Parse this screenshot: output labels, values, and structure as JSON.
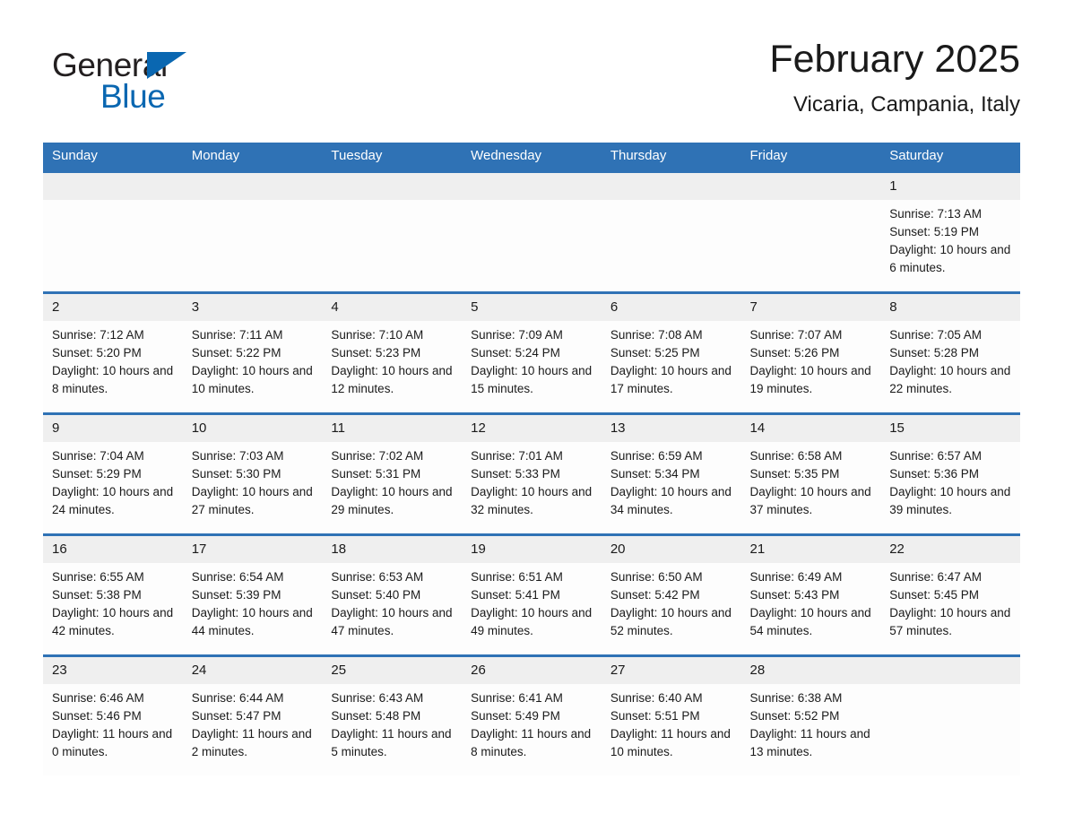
{
  "brand": {
    "name_part1": "General",
    "name_part2": "Blue",
    "accent_color": "#0a67b1"
  },
  "header": {
    "title": "February 2025",
    "subtitle": "Vicaria, Campania, Italy"
  },
  "theme": {
    "header_blue": "#2f72b5",
    "daynum_gray": "#efefef"
  },
  "weekday_headers": [
    "Sunday",
    "Monday",
    "Tuesday",
    "Wednesday",
    "Thursday",
    "Friday",
    "Saturday"
  ],
  "weeks": [
    [
      {
        "day": "",
        "sunrise": "",
        "sunset": "",
        "daylight": ""
      },
      {
        "day": "",
        "sunrise": "",
        "sunset": "",
        "daylight": ""
      },
      {
        "day": "",
        "sunrise": "",
        "sunset": "",
        "daylight": ""
      },
      {
        "day": "",
        "sunrise": "",
        "sunset": "",
        "daylight": ""
      },
      {
        "day": "",
        "sunrise": "",
        "sunset": "",
        "daylight": ""
      },
      {
        "day": "",
        "sunrise": "",
        "sunset": "",
        "daylight": ""
      },
      {
        "day": "1",
        "sunrise": "Sunrise: 7:13 AM",
        "sunset": "Sunset: 5:19 PM",
        "daylight": "Daylight: 10 hours and 6 minutes."
      }
    ],
    [
      {
        "day": "2",
        "sunrise": "Sunrise: 7:12 AM",
        "sunset": "Sunset: 5:20 PM",
        "daylight": "Daylight: 10 hours and 8 minutes."
      },
      {
        "day": "3",
        "sunrise": "Sunrise: 7:11 AM",
        "sunset": "Sunset: 5:22 PM",
        "daylight": "Daylight: 10 hours and 10 minutes."
      },
      {
        "day": "4",
        "sunrise": "Sunrise: 7:10 AM",
        "sunset": "Sunset: 5:23 PM",
        "daylight": "Daylight: 10 hours and 12 minutes."
      },
      {
        "day": "5",
        "sunrise": "Sunrise: 7:09 AM",
        "sunset": "Sunset: 5:24 PM",
        "daylight": "Daylight: 10 hours and 15 minutes."
      },
      {
        "day": "6",
        "sunrise": "Sunrise: 7:08 AM",
        "sunset": "Sunset: 5:25 PM",
        "daylight": "Daylight: 10 hours and 17 minutes."
      },
      {
        "day": "7",
        "sunrise": "Sunrise: 7:07 AM",
        "sunset": "Sunset: 5:26 PM",
        "daylight": "Daylight: 10 hours and 19 minutes."
      },
      {
        "day": "8",
        "sunrise": "Sunrise: 7:05 AM",
        "sunset": "Sunset: 5:28 PM",
        "daylight": "Daylight: 10 hours and 22 minutes."
      }
    ],
    [
      {
        "day": "9",
        "sunrise": "Sunrise: 7:04 AM",
        "sunset": "Sunset: 5:29 PM",
        "daylight": "Daylight: 10 hours and 24 minutes."
      },
      {
        "day": "10",
        "sunrise": "Sunrise: 7:03 AM",
        "sunset": "Sunset: 5:30 PM",
        "daylight": "Daylight: 10 hours and 27 minutes."
      },
      {
        "day": "11",
        "sunrise": "Sunrise: 7:02 AM",
        "sunset": "Sunset: 5:31 PM",
        "daylight": "Daylight: 10 hours and 29 minutes."
      },
      {
        "day": "12",
        "sunrise": "Sunrise: 7:01 AM",
        "sunset": "Sunset: 5:33 PM",
        "daylight": "Daylight: 10 hours and 32 minutes."
      },
      {
        "day": "13",
        "sunrise": "Sunrise: 6:59 AM",
        "sunset": "Sunset: 5:34 PM",
        "daylight": "Daylight: 10 hours and 34 minutes."
      },
      {
        "day": "14",
        "sunrise": "Sunrise: 6:58 AM",
        "sunset": "Sunset: 5:35 PM",
        "daylight": "Daylight: 10 hours and 37 minutes."
      },
      {
        "day": "15",
        "sunrise": "Sunrise: 6:57 AM",
        "sunset": "Sunset: 5:36 PM",
        "daylight": "Daylight: 10 hours and 39 minutes."
      }
    ],
    [
      {
        "day": "16",
        "sunrise": "Sunrise: 6:55 AM",
        "sunset": "Sunset: 5:38 PM",
        "daylight": "Daylight: 10 hours and 42 minutes."
      },
      {
        "day": "17",
        "sunrise": "Sunrise: 6:54 AM",
        "sunset": "Sunset: 5:39 PM",
        "daylight": "Daylight: 10 hours and 44 minutes."
      },
      {
        "day": "18",
        "sunrise": "Sunrise: 6:53 AM",
        "sunset": "Sunset: 5:40 PM",
        "daylight": "Daylight: 10 hours and 47 minutes."
      },
      {
        "day": "19",
        "sunrise": "Sunrise: 6:51 AM",
        "sunset": "Sunset: 5:41 PM",
        "daylight": "Daylight: 10 hours and 49 minutes."
      },
      {
        "day": "20",
        "sunrise": "Sunrise: 6:50 AM",
        "sunset": "Sunset: 5:42 PM",
        "daylight": "Daylight: 10 hours and 52 minutes."
      },
      {
        "day": "21",
        "sunrise": "Sunrise: 6:49 AM",
        "sunset": "Sunset: 5:43 PM",
        "daylight": "Daylight: 10 hours and 54 minutes."
      },
      {
        "day": "22",
        "sunrise": "Sunrise: 6:47 AM",
        "sunset": "Sunset: 5:45 PM",
        "daylight": "Daylight: 10 hours and 57 minutes."
      }
    ],
    [
      {
        "day": "23",
        "sunrise": "Sunrise: 6:46 AM",
        "sunset": "Sunset: 5:46 PM",
        "daylight": "Daylight: 11 hours and 0 minutes."
      },
      {
        "day": "24",
        "sunrise": "Sunrise: 6:44 AM",
        "sunset": "Sunset: 5:47 PM",
        "daylight": "Daylight: 11 hours and 2 minutes."
      },
      {
        "day": "25",
        "sunrise": "Sunrise: 6:43 AM",
        "sunset": "Sunset: 5:48 PM",
        "daylight": "Daylight: 11 hours and 5 minutes."
      },
      {
        "day": "26",
        "sunrise": "Sunrise: 6:41 AM",
        "sunset": "Sunset: 5:49 PM",
        "daylight": "Daylight: 11 hours and 8 minutes."
      },
      {
        "day": "27",
        "sunrise": "Sunrise: 6:40 AM",
        "sunset": "Sunset: 5:51 PM",
        "daylight": "Daylight: 11 hours and 10 minutes."
      },
      {
        "day": "28",
        "sunrise": "Sunrise: 6:38 AM",
        "sunset": "Sunset: 5:52 PM",
        "daylight": "Daylight: 11 hours and 13 minutes."
      },
      {
        "day": "",
        "sunrise": "",
        "sunset": "",
        "daylight": ""
      }
    ]
  ]
}
